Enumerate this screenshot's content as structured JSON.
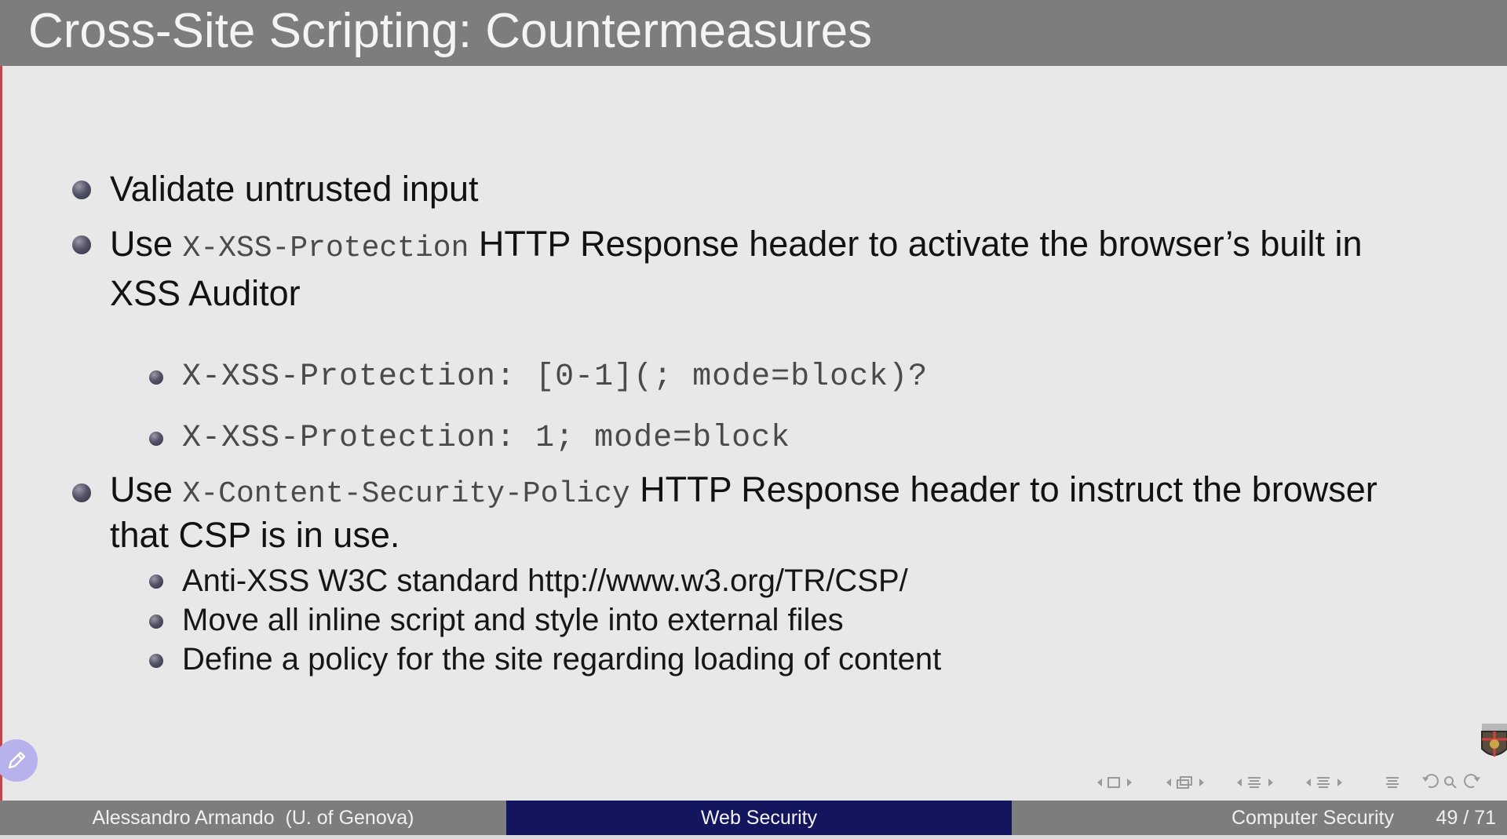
{
  "slide": {
    "title": "Cross-Site Scripting: Countermeasures"
  },
  "bullets": {
    "b1": {
      "text": "Validate untrusted input"
    },
    "b2": {
      "pre": "Use ",
      "code": "X-XSS-Protection",
      "post_line1": " HTTP Response header to activate the browser’s built in",
      "post_line2": "XSS Auditor"
    },
    "b2_sub": [
      "X-XSS-Protection: [0-1](; mode=block)?",
      "X-XSS-Protection: 1; mode=block"
    ],
    "b3": {
      "pre": "Use ",
      "code": "X-Content-Security-Policy",
      "post_line1": " HTTP Response header to instruct the browser",
      "post_line2": "that CSP is in use."
    },
    "b3_sub": [
      "Anti-XSS W3C standard http://www.w3.org/TR/CSP/",
      "Move all inline script and style into external files",
      "Define a policy for the site regarding loading of content"
    ]
  },
  "footer": {
    "author": "Alessandro Armando  (U. of Genova)",
    "section": "Web Security",
    "course": "Computer Security",
    "page": "49 / 71"
  },
  "icons": {
    "annotate": "pencil-icon",
    "logo": "university-crest-icon",
    "navigation": [
      "nav-frame-icons",
      "nav-subsection-icons",
      "nav-section-icons",
      "nav-toc-icon",
      "nav-back-icon",
      "nav-zoom-icon",
      "nav-forward-icon"
    ]
  },
  "colors": {
    "title_bar": "#7d7d7d",
    "footer_section": "#13155e",
    "background": "#e8e8e8",
    "edge": "#c8444a"
  }
}
